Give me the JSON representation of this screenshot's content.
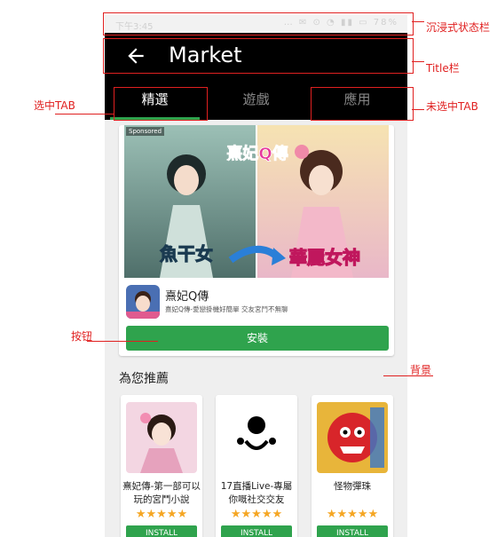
{
  "phone": {
    "statusbar": {
      "time": "下午3:45",
      "icons": "… ✉ ⊙ ◔ ▮▮ ▭ 78%"
    },
    "titlebar": {
      "title": "Market"
    },
    "tabs": [
      {
        "label": "精選",
        "active": true
      },
      {
        "label": "遊戲",
        "active": false
      },
      {
        "label": "應用",
        "active": false
      }
    ],
    "featured": {
      "sponsored_label": "Sponsored",
      "banner_logo": "熹妃Q傳",
      "banner_left_text": "魚干女",
      "banner_right_text": "華麗女神",
      "app_name": "熹妃Q傳",
      "app_desc": "熹妃Q傳-愛戀掛機好簡單 交友宮鬥不無聊",
      "install_label": "安裝"
    },
    "recommend": {
      "title": "為您推薦",
      "items": [
        {
          "name": "熹妃傳-第一部可以玩的宮鬥小說",
          "stars": "★★★★★",
          "install": "INSTALL"
        },
        {
          "name": "17直播Live-專屬你嘅社交交友",
          "stars": "★★★★★",
          "install": "INSTALL"
        },
        {
          "name": "怪物彈珠",
          "stars": "★★★★★",
          "install": "INSTALL"
        }
      ]
    }
  },
  "annotations": {
    "statusbar": "沉浸式状态栏",
    "titlebar": "Title栏",
    "selected_tab": "选中TAB",
    "unselected_tab": "未选中TAB",
    "button": "按钮",
    "background": "背景"
  },
  "colors": {
    "accent_green": "#2fa34d",
    "titlebar_bg": "#000000",
    "annotation_red": "#e02020",
    "star": "#f5a623"
  }
}
